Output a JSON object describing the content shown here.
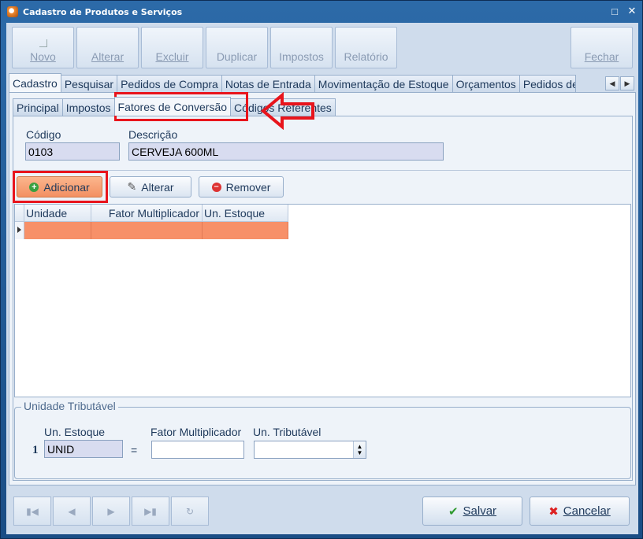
{
  "window": {
    "title": "Cadastro de Produtos e Serviços"
  },
  "toolbar": {
    "novo": "Novo",
    "alterar": "Alterar",
    "excluir": "Excluir",
    "duplicar": "Duplicar",
    "impostos": "Impostos",
    "relatorio": "Relatório",
    "fechar": "Fechar"
  },
  "main_tabs": [
    "Cadastro",
    "Pesquisar",
    "Pedidos de Compra",
    "Notas de Entrada",
    "Movimentação de Estoque",
    "Orçamentos",
    "Pedidos de"
  ],
  "sub_tabs": [
    "Principal",
    "Impostos",
    "Fatores de Conversão",
    "Códigos Referentes"
  ],
  "form": {
    "codigo_label": "Código",
    "codigo_value": "0103",
    "descricao_label": "Descrição",
    "descricao_value": "CERVEJA 600ML"
  },
  "actions": {
    "adicionar": "Adicionar",
    "alterar": "Alterar",
    "remover": "Remover"
  },
  "grid": {
    "columns": [
      "Unidade",
      "Fator Multiplicador",
      "Un. Estoque"
    ]
  },
  "unidade_tributavel": {
    "legend": "Unidade Tributável",
    "row_number": "1",
    "un_estoque_label": "Un. Estoque",
    "un_estoque_value": "UNID",
    "equals": "=",
    "fator_label": "Fator Multiplicador",
    "un_tributavel_label": "Un. Tributável"
  },
  "footer": {
    "salvar": "Salvar",
    "cancelar": "Cancelar"
  },
  "colors": {
    "highlight": "#e8141c",
    "selected_row": "#f79068",
    "accent": "#1e395b"
  }
}
